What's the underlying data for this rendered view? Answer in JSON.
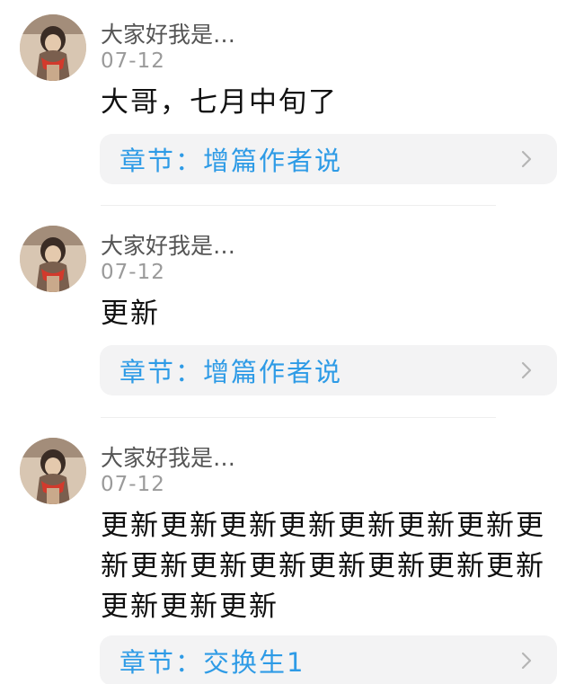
{
  "comments": [
    {
      "username": "大家好我是…",
      "date": "07-12",
      "text": "大哥，七月中旬了",
      "chapter": "章节：增篇作者说"
    },
    {
      "username": "大家好我是…",
      "date": "07-12",
      "text": "更新",
      "chapter": "章节：增篇作者说"
    },
    {
      "username": "大家好我是…",
      "date": "07-12",
      "text": "更新更新更新更新更新更新更新更新更新更新更新更新更新更新更新更新更新更新",
      "chapter": "章节：交换生1"
    }
  ],
  "icons": {
    "avatar": "user-avatar-icon",
    "chevron": "chevron-right-icon"
  },
  "colors": {
    "chapter_link": "#2e9be6",
    "chapter_bg": "#f3f3f4",
    "username": "#555555",
    "date": "#9a9a9a"
  }
}
